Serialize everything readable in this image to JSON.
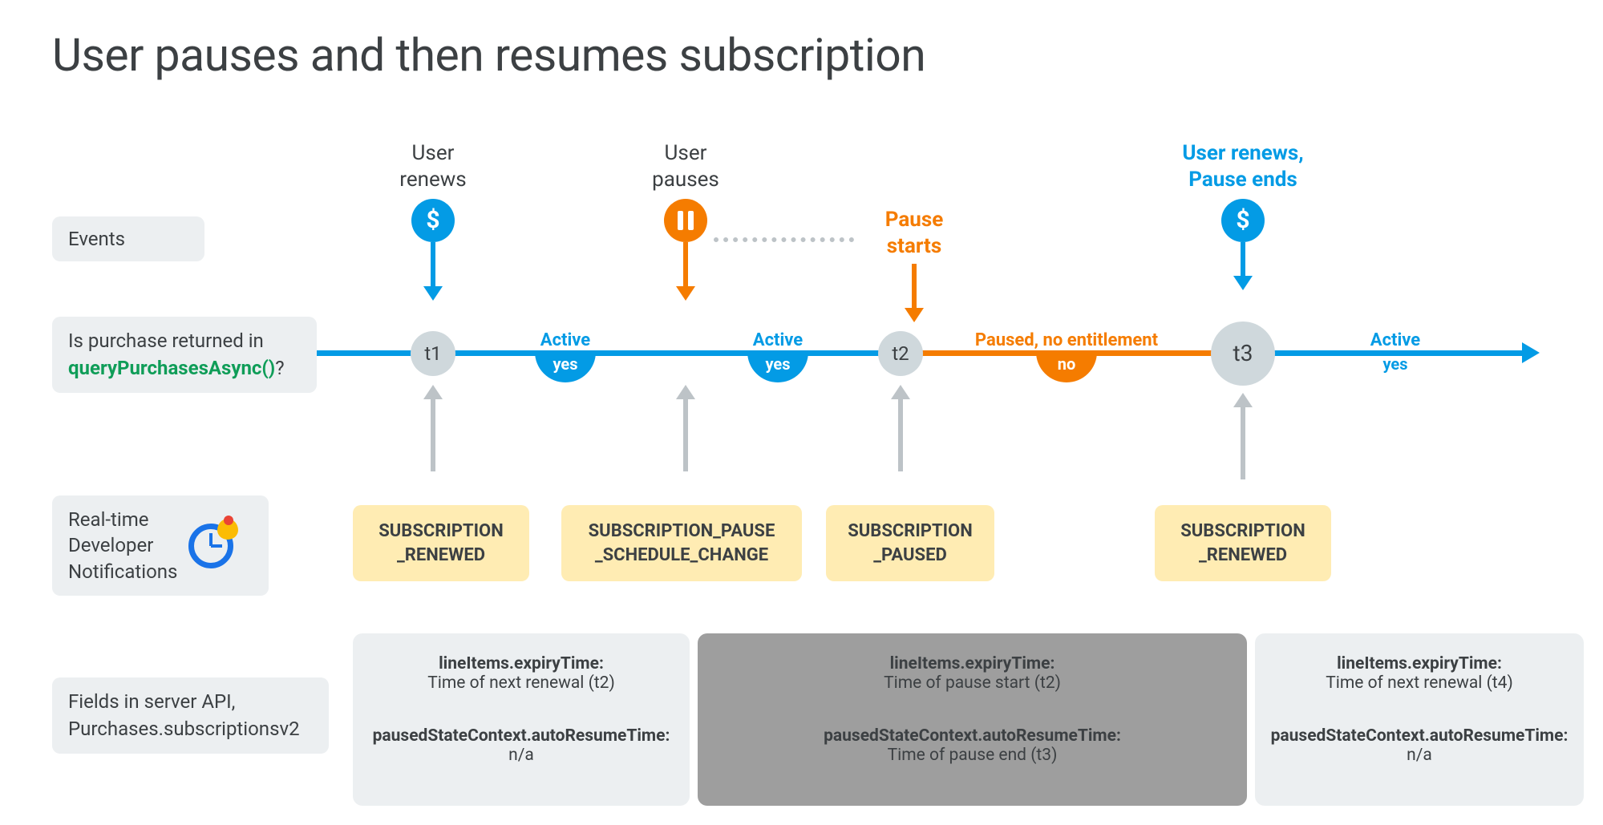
{
  "title": "User pauses and then resumes subscription",
  "rows": {
    "events": "Events",
    "query_prefix": "Is purchase returned in ",
    "query_fn": "queryPurchasesAsync()",
    "query_suffix": "?",
    "rtdn_l1": "Real-time",
    "rtdn_l2": "Developer",
    "rtdn_l3": "Notifications",
    "fields_l1": "Fields in server API,",
    "fields_l2": "Purchases.subscriptionsv2"
  },
  "events": {
    "renews": {
      "l1": "User",
      "l2": "renews"
    },
    "pauses": {
      "l1": "User",
      "l2": "pauses"
    },
    "pause_starts": {
      "l1": "Pause",
      "l2": "starts"
    },
    "resumes": {
      "l1": "User renews,",
      "l2": "Pause ends"
    }
  },
  "nodes": {
    "t1": "t1",
    "t2": "t2",
    "t3": "t3"
  },
  "segments": {
    "active": {
      "status": "Active",
      "answer": "yes"
    },
    "paused": {
      "status": "Paused, no entitlement",
      "answer": "no"
    }
  },
  "notifications": {
    "renewed": {
      "l1": "SUBSCRIPTION",
      "l2": "_RENEWED"
    },
    "pause_sched": {
      "l1": "SUBSCRIPTION_PAUSE",
      "l2": "_SCHEDULE_CHANGE"
    },
    "paused": {
      "l1": "SUBSCRIPTION",
      "l2": "_PAUSED"
    }
  },
  "fields": {
    "col1": {
      "k1": "lineItems.expiryTime:",
      "v1": "Time of next renewal (t2)",
      "k2": "pausedStateContext.autoResumeTime:",
      "v2": "n/a"
    },
    "col2": {
      "k1": "lineItems.expiryTime:",
      "v1": "Time of pause start (t2)",
      "k2": "pausedStateContext.autoResumeTime:",
      "v2": "Time of pause end (t3)"
    },
    "col3": {
      "k1": "lineItems.expiryTime:",
      "v1": "Time of next renewal (t4)",
      "k2": "pausedStateContext.autoResumeTime:",
      "v2": "n/a"
    }
  }
}
